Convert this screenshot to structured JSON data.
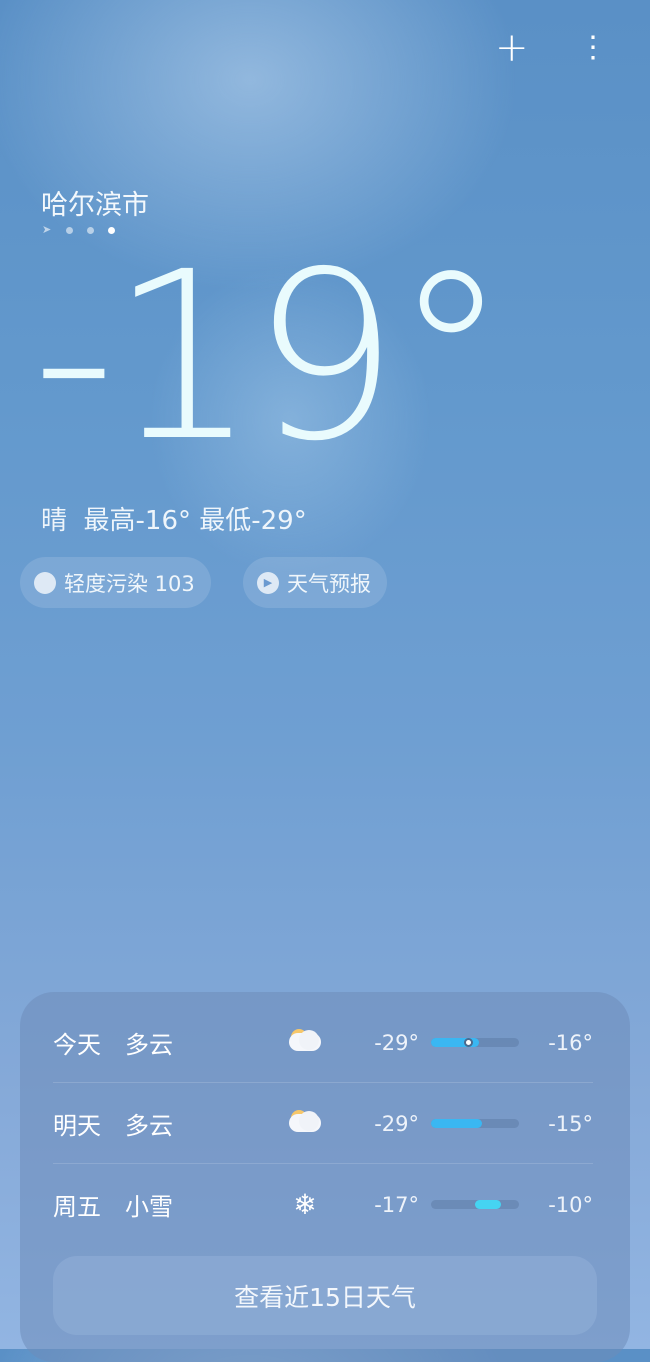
{
  "header": {
    "add_icon": "plus-icon",
    "menu_icon": "more-vertical-icon"
  },
  "location": {
    "city": "哈尔滨市",
    "page_count": 4,
    "active_page": 4
  },
  "current": {
    "temperature": "-19°",
    "summary": "晴  最高-16° 最低-29°"
  },
  "chips": [
    {
      "icon": "mask-icon",
      "label": "轻度污染 103"
    },
    {
      "icon": "play-icon",
      "label": "天气预报"
    }
  ],
  "forecast": [
    {
      "day": "今天",
      "condition": "多云",
      "icon": "partly-cloudy-icon",
      "low": "-29°",
      "high": "-16°",
      "bar_start": 0,
      "bar_end": 0.55,
      "current_marker": 0.38
    },
    {
      "day": "明天",
      "condition": "多云",
      "icon": "partly-cloudy-icon",
      "low": "-29°",
      "high": "-15°",
      "bar_start": 0,
      "bar_end": 0.58
    },
    {
      "day": "周五",
      "condition": "小雪",
      "icon": "snowflake-icon",
      "low": "-17°",
      "high": "-10°",
      "bar_start": 0.5,
      "bar_end": 0.8
    }
  ],
  "more_button": "查看近15日天气",
  "colors": {
    "bar_fill": "#3ab7f2",
    "snow_bar": "#45d4f2"
  }
}
